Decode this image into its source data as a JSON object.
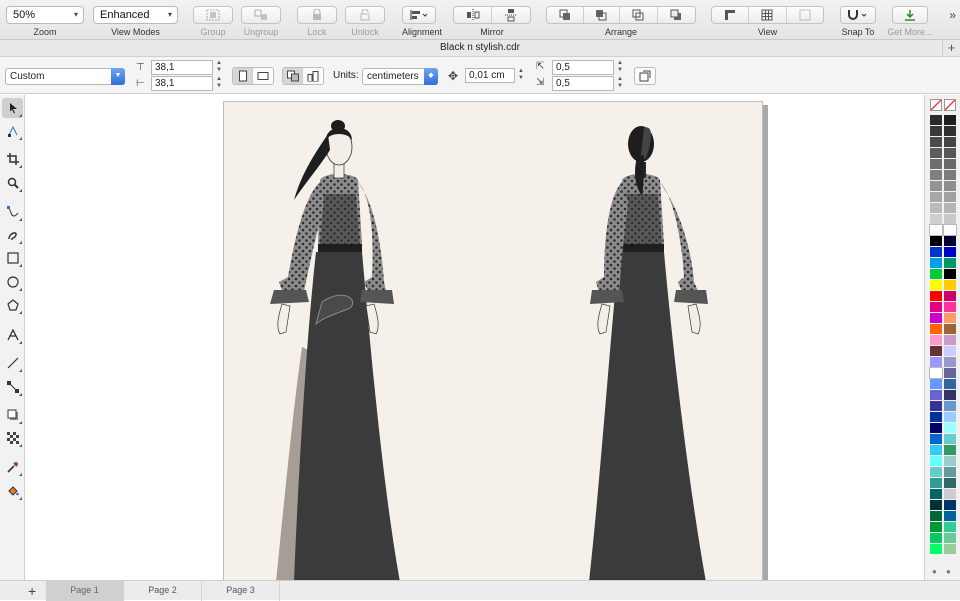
{
  "toolbar": {
    "zoom": {
      "value": "50%",
      "label": "Zoom"
    },
    "view_modes": {
      "value": "Enhanced",
      "label": "View Modes"
    },
    "group": "Group",
    "ungroup": "Ungroup",
    "lock": "Lock",
    "unlock": "Unlock",
    "alignment": "Alignment",
    "mirror": "Mirror",
    "arrange": "Arrange",
    "view": "View",
    "snap_to": "Snap To",
    "get_more": "Get More..."
  },
  "document": {
    "title": "Black n stylish.cdr"
  },
  "propbar": {
    "page_size": "Custom",
    "width": "38,1",
    "height": "38,1",
    "units_label": "Units:",
    "units": "centimeters",
    "nudge": "0,01 cm",
    "dup_x": "0,5",
    "dup_y": "0,5"
  },
  "pages": [
    {
      "label": "Page 1",
      "active": true
    },
    {
      "label": "Page 2",
      "active": false
    },
    {
      "label": "Page 3",
      "active": false
    }
  ],
  "palette": {
    "col1": [
      "#2b2b2b",
      "#3a3a3a",
      "#4a4a4a",
      "#5c5c5c",
      "#6d6d6d",
      "#808080",
      "#939393",
      "#a6a6a6",
      "#bababa",
      "#cfcfcf",
      "#ffffff",
      "#000000",
      "#0033cc",
      "#00a0e9",
      "#00cc33",
      "#ffff00",
      "#ff0000",
      "#e6007e",
      "#cc00cc",
      "#ff6600",
      "#ff99cc",
      "#663333",
      "#9999ff",
      "#ffffff",
      "#6699ff",
      "#6666cc",
      "#333399",
      "#003399",
      "#000066",
      "#0066cc",
      "#33ccff",
      "#66ffff",
      "#66cccc",
      "#339999",
      "#006666",
      "#003333",
      "#006633",
      "#009933",
      "#00cc66",
      "#00ff66"
    ],
    "col2": [
      "#1e1e1e",
      "#2f2f2f",
      "#444444",
      "#575757",
      "#696969",
      "#7b7b7b",
      "#8e8e8e",
      "#a1a1a1",
      "#b5b5b5",
      "#c9c9c9",
      "#ffffff",
      "#000033",
      "#0000cc",
      "#009966",
      "#000000",
      "#ffcc00",
      "#cc0066",
      "#ff3399",
      "#ff9966",
      "#996633",
      "#cc99cc",
      "#ccccff",
      "#9999cc",
      "#666699",
      "#336699",
      "#333366",
      "#6699cc",
      "#99ccff",
      "#99ffff",
      "#66cccc",
      "#339966",
      "#99cccc",
      "#669999",
      "#336666",
      "#cccccc",
      "#003366",
      "#006699",
      "#33cc99",
      "#66cc99",
      "#99cc99"
    ]
  },
  "icons": {
    "zoom_chev": "chevron-down-icon",
    "select_tool": "pick-tool-icon"
  }
}
